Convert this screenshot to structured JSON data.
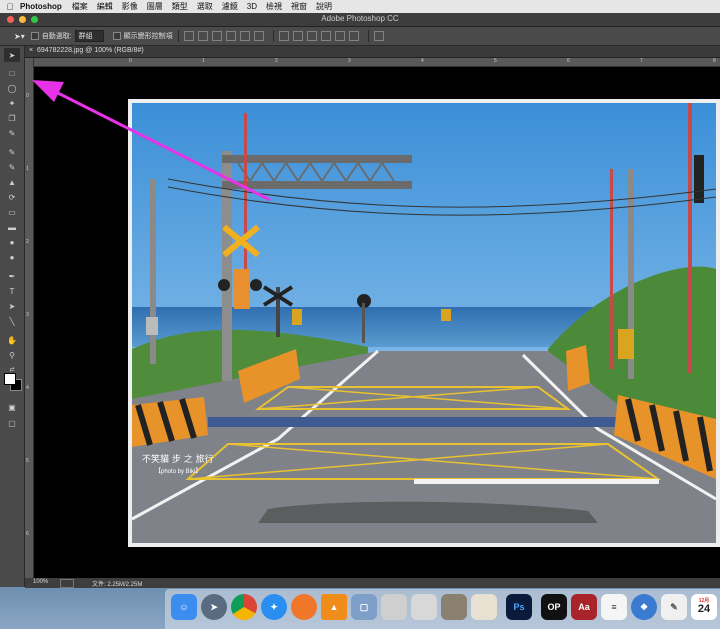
{
  "menubar": {
    "app_name": "Photoshop",
    "items": [
      "檔案",
      "編輯",
      "影像",
      "圖層",
      "類型",
      "選取",
      "濾鏡",
      "3D",
      "檢視",
      "視窗",
      "說明"
    ]
  },
  "window": {
    "title": "Adobe Photoshop CC",
    "traffic_colors": [
      "#fc605b",
      "#fdbc40",
      "#34c84a"
    ]
  },
  "options_bar": {
    "auto_select_label": "自動選取:",
    "auto_select_value": "群組",
    "show_transform_label": "顯示變形控制項"
  },
  "document": {
    "tab_title": "694782228.jpg @ 100% (RGB/8#)",
    "close_glyph": "×",
    "ruler_h_ticks": [
      "0",
      "1",
      "2",
      "3",
      "4",
      "5",
      "6",
      "7",
      "8"
    ],
    "ruler_v_ticks": [
      "0",
      "1",
      "2",
      "3",
      "4",
      "5",
      "6"
    ]
  },
  "photo": {
    "watermark_line1": "不笑貓 步 之 旅行",
    "watermark_line2": "【photo by Biki】"
  },
  "status": {
    "zoom": "100%",
    "doc_size": "文件: 2.25M/2.25M"
  },
  "dock": {
    "ps_label": "Ps",
    "dxo_label": "OP",
    "calendar_month": "12月",
    "calendar_day": "24"
  },
  "annotation": {
    "arrow_color": "#e832e8"
  }
}
